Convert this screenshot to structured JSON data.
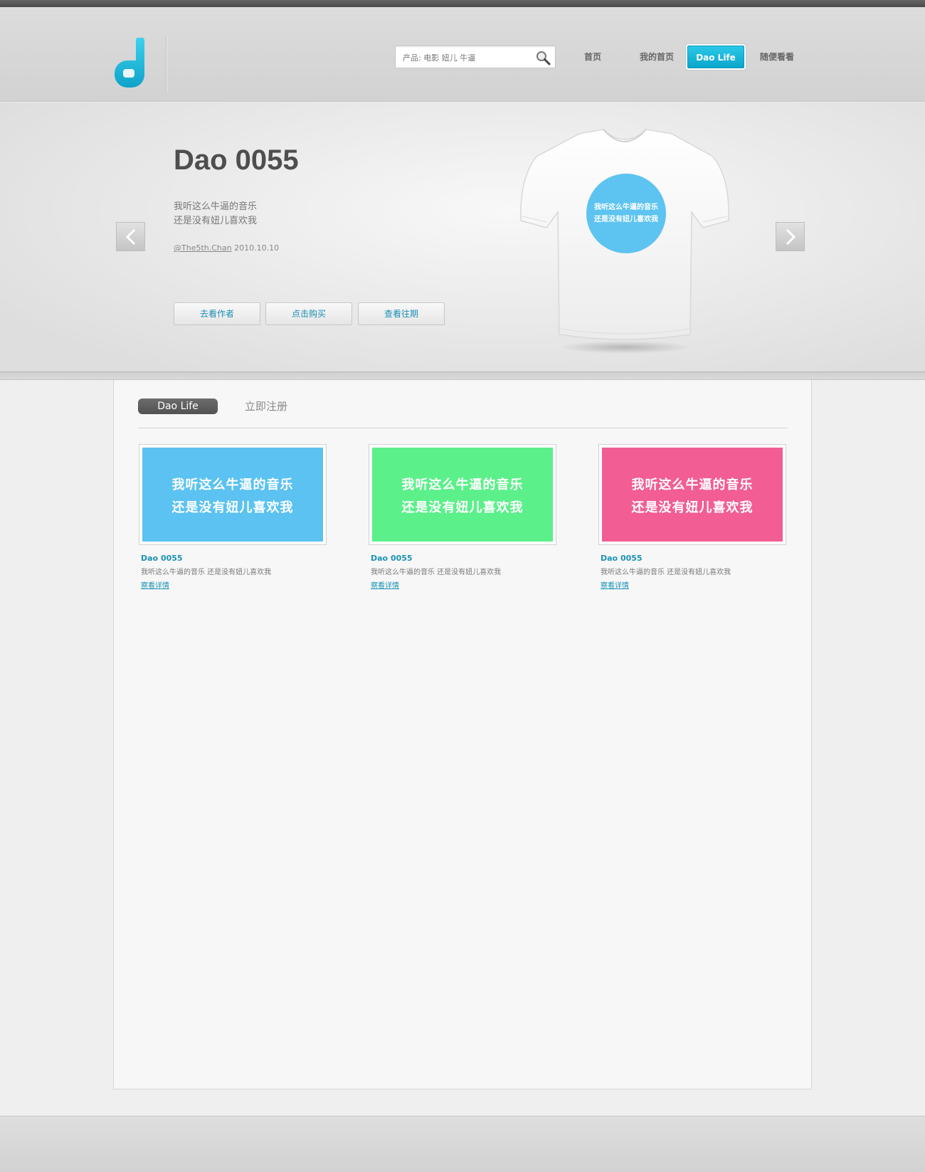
{
  "header": {
    "search": {
      "placeholder": "产品: 电影 妞儿 牛逼"
    },
    "nav": [
      "首页",
      "我的首页",
      "Dao Life",
      "随便看看"
    ],
    "colors": {
      "accent": "#0aa6cc"
    }
  },
  "hero": {
    "title": "Dao 0055",
    "lines": [
      "我听这么牛逼的音乐",
      "还是没有妞儿喜欢我"
    ],
    "author": "@The5th.Chan",
    "date": "2010.10.10",
    "buttons": [
      "去看作者",
      "点击购买",
      "查看往期"
    ],
    "tshirt_print": [
      "我听这么牛逼的音乐",
      "还是没有妞儿喜欢我"
    ]
  },
  "main": {
    "tabs": [
      "Dao Life",
      "立即注册"
    ],
    "cards": [
      {
        "color": "#5bc2f1",
        "lines": [
          "我听这么牛逼的音乐",
          "还是没有妞儿喜欢我"
        ],
        "title": "Dao 0055",
        "desc": "我听这么牛逼的音乐 还是没有妞儿喜欢我",
        "link": "察看详情"
      },
      {
        "color": "#5bf08a",
        "lines": [
          "我听这么牛逼的音乐",
          "还是没有妞儿喜欢我"
        ],
        "title": "Dao 0055",
        "desc": "我听这么牛逼的音乐 还是没有妞儿喜欢我",
        "link": "察看详情"
      },
      {
        "color": "#f25d93",
        "lines": [
          "我听这么牛逼的音乐",
          "还是没有妞儿喜欢我"
        ],
        "title": "Dao 0055",
        "desc": "我听这么牛逼的音乐 还是没有妞儿喜欢我",
        "link": "察看详情"
      }
    ]
  }
}
